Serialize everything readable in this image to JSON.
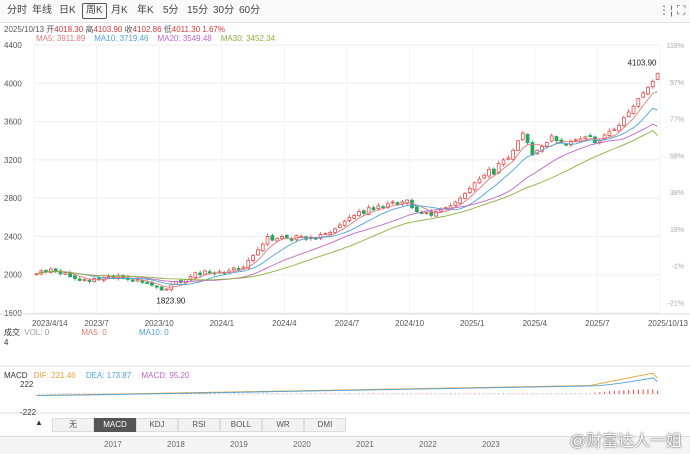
{
  "tabs": [
    {
      "label": "分时",
      "active": false
    },
    {
      "label": "年线",
      "active": false
    },
    {
      "label": "日K",
      "active": false
    },
    {
      "label": "周K",
      "active": true
    },
    {
      "label": "月K",
      "active": false
    },
    {
      "label": "年K",
      "active": false
    },
    {
      "label": "5分",
      "active": false
    },
    {
      "label": "15分",
      "active": false
    },
    {
      "label": "30分",
      "active": false
    },
    {
      "label": "60分",
      "active": false
    }
  ],
  "tools": {
    "crosshair": "⋮¦",
    "fullscreen": "⛶"
  },
  "quote": {
    "date": "2025/10/13",
    "open_label": "开",
    "open": "4018.30",
    "high_label": "高",
    "high": "4103.90",
    "close_label": "收",
    "close": "4102.86",
    "low_label": "低",
    "low": "4011.30",
    "change": "1.67%"
  },
  "ma_legend": [
    {
      "label": "MA5: 3911.89",
      "color": "#e07a7a"
    },
    {
      "label": "MA10: 3719.46",
      "color": "#4fa3d9"
    },
    {
      "label": "MA20: 3549.48",
      "color": "#c266c2"
    },
    {
      "label": "MA30: 3452.34",
      "color": "#8fb03e"
    }
  ],
  "volume_legend": {
    "title": "成交",
    "vol": "VOL: 0",
    "ma5": "MA5: 0",
    "ma10": "MA10: 0",
    "level": "4"
  },
  "macd_legend": {
    "title": "MACD",
    "dif": "DIF: 221.46",
    "dea": "DEA: 173.87",
    "macd": "MACD: 95.20",
    "ytop": "222",
    "ybottom": "-222"
  },
  "indicator_tabs": [
    {
      "label": "无",
      "active": false
    },
    {
      "label": "MACD",
      "active": true
    },
    {
      "label": "KDJ",
      "active": false
    },
    {
      "label": "RSI",
      "active": false
    },
    {
      "label": "BOLL",
      "active": false
    },
    {
      "label": "WR",
      "active": false
    },
    {
      "label": "DMI",
      "active": false
    }
  ],
  "nav": {
    "up": "▲",
    "down": "▼"
  },
  "overview_years": [
    "2017",
    "2018",
    "2019",
    "2020",
    "2021",
    "2022",
    "2023"
  ],
  "watermark_text": "@财富达人一姐",
  "chart_data": {
    "type": "candlestick",
    "colors": {
      "up": "#e24b4b",
      "down": "#25a65a",
      "ma5": "#e07a7a",
      "ma10": "#4fa3d9",
      "ma20": "#c266c2",
      "ma30": "#8fb03e"
    },
    "price_ticks": [
      "4400",
      "4000",
      "3600",
      "3200",
      "2800",
      "2400",
      "2000",
      "1600"
    ],
    "pct_ticks": [
      "118%",
      "97%",
      "77%",
      "58%",
      "38%",
      "18%",
      "-1%",
      "-21%"
    ],
    "x_ticks": [
      "2023/4/14",
      "2023/7",
      "2023/10",
      "2024/1",
      "2024/4",
      "2024/7",
      "2024/10",
      "2025/1",
      "2025/4",
      "2025/7",
      "2025/10/13"
    ],
    "ylim": [
      1600,
      4400
    ],
    "annotations": [
      {
        "label": "4103.90",
        "price": 4103.9,
        "index": 129
      },
      {
        "label": "1823.90",
        "price": 1823.9,
        "index": 27
      }
    ],
    "closes": [
      2010,
      2040,
      2030,
      2060,
      2030,
      2010,
      2020,
      1980,
      1960,
      1940,
      1950,
      1930,
      1960,
      1950,
      1970,
      1980,
      1970,
      1990,
      1960,
      1950,
      1930,
      1950,
      1920,
      1910,
      1890,
      1870,
      1840,
      1850,
      1900,
      1930,
      1920,
      1950,
      1980,
      2020,
      2000,
      2040,
      2020,
      2010,
      2030,
      2020,
      2040,
      2070,
      2060,
      2080,
      2150,
      2200,
      2260,
      2320,
      2400,
      2360,
      2380,
      2400,
      2380,
      2360,
      2410,
      2400,
      2370,
      2390,
      2380,
      2420,
      2430,
      2440,
      2480,
      2520,
      2560,
      2600,
      2620,
      2660,
      2640,
      2700,
      2680,
      2720,
      2700,
      2740,
      2760,
      2730,
      2760,
      2780,
      2700,
      2660,
      2640,
      2650,
      2620,
      2660,
      2680,
      2700,
      2720,
      2760,
      2800,
      2850,
      2900,
      2960,
      3000,
      3040,
      3100,
      3050,
      3160,
      3200,
      3220,
      3300,
      3400,
      3480,
      3380,
      3250,
      3300,
      3340,
      3380,
      3450,
      3400,
      3380,
      3360,
      3390,
      3410,
      3420,
      3440,
      3450,
      3380,
      3400,
      3460,
      3500,
      3520,
      3560,
      3640,
      3700,
      3760,
      3840,
      3900,
      3960,
      4020,
      4102.86
    ],
    "ma5_last": 3911.89,
    "ma10_last": 3719.46,
    "ma20_last": 3549.48,
    "ma30_last": 3452.34,
    "macd": {
      "dif_last": 221.46,
      "dea_last": 173.87,
      "macd_last": 95.2,
      "ylim": [
        -222,
        222
      ]
    }
  }
}
